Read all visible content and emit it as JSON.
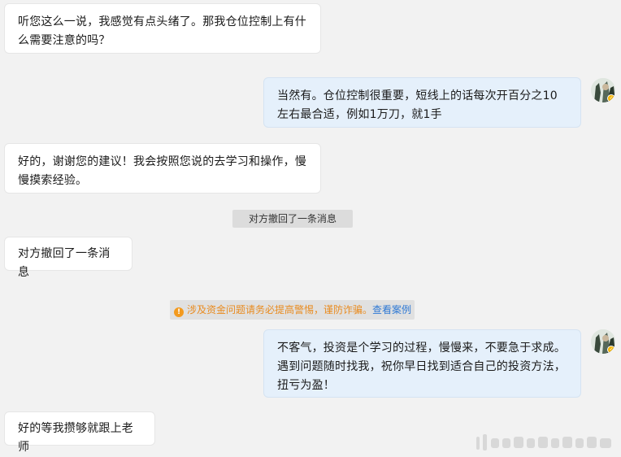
{
  "messages": [
    {
      "side": "left",
      "text": "听您这么一说，我感觉有点头绪了。那我仓位控制上有什么需要注意的吗？"
    },
    {
      "side": "right",
      "text": "当然有。仓位控制很重要，短线上的话每次开百分之10左右最合适，例如1万刀，就1手"
    },
    {
      "side": "left",
      "text": "好的，谢谢您的建议！我会按照您说的去学习和操作，慢慢摸索经验。"
    },
    {
      "side": "system",
      "text": "对方撤回了一条消息"
    },
    {
      "side": "left",
      "text": "对方撤回了一条消息"
    },
    {
      "side": "right",
      "text": "不客气，投资是个学习的过程，慢慢来，不要急于求成。遇到问题随时找我，祝你早日找到适合自己的投资方法，扭亏为盈！"
    },
    {
      "side": "left",
      "text": "好的等我攒够就跟上老师"
    }
  ],
  "notice": {
    "text": "涉及资金问题请务必提高警惕，谨防诈骗。",
    "link": "查看案例",
    "icon": "warning-icon",
    "color": "#e98b1f",
    "link_color": "#2f79d4"
  },
  "avatar": {
    "icon": "avatar-photo"
  }
}
